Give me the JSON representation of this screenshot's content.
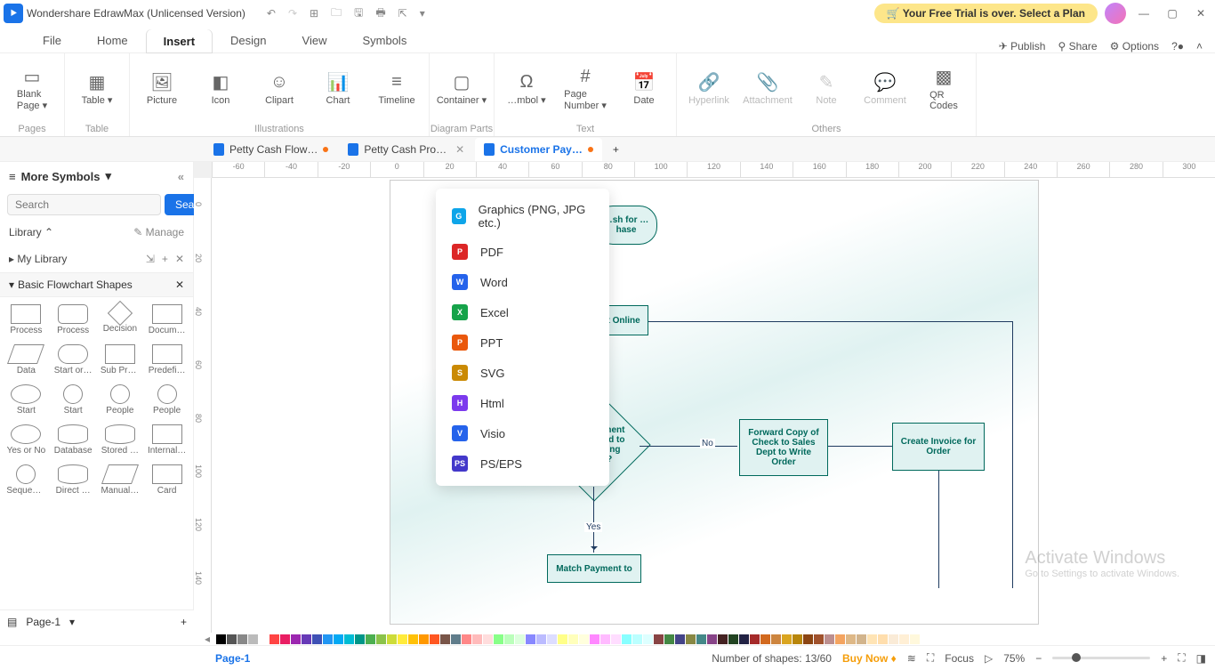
{
  "app": {
    "title": "Wondershare EdrawMax (Unlicensed Version)",
    "trial_banner": "Your Free Trial is over. Select a Plan"
  },
  "menu": {
    "tabs": [
      "File",
      "Home",
      "Insert",
      "Design",
      "View",
      "Symbols"
    ],
    "active": "Insert",
    "right": {
      "publish": "Publish",
      "share": "Share",
      "options": "Options"
    }
  },
  "ribbon": {
    "groups": [
      {
        "label": "Pages",
        "items": [
          {
            "name": "blank-page",
            "label": "Blank\nPage ▾",
            "icon": "▭"
          }
        ]
      },
      {
        "label": "Table",
        "items": [
          {
            "name": "table",
            "label": "Table ▾",
            "icon": "▦"
          }
        ]
      },
      {
        "label": "Illustrations",
        "items": [
          {
            "name": "picture",
            "label": "Picture",
            "icon": "🖼"
          },
          {
            "name": "icon",
            "label": "Icon",
            "icon": "◧"
          },
          {
            "name": "clipart",
            "label": "Clipart",
            "icon": "☺"
          },
          {
            "name": "chart",
            "label": "Chart",
            "icon": "📊"
          },
          {
            "name": "timeline",
            "label": "Timeline",
            "icon": "≡"
          }
        ]
      },
      {
        "label": "Diagram Parts",
        "items": [
          {
            "name": "container",
            "label": "Container ▾",
            "icon": "▢"
          }
        ]
      },
      {
        "label": "Text",
        "items": [
          {
            "name": "symbol",
            "label": "…mbol ▾",
            "icon": "Ω"
          },
          {
            "name": "page-number",
            "label": "Page\nNumber ▾",
            "icon": "#"
          },
          {
            "name": "date",
            "label": "Date",
            "icon": "📅"
          }
        ]
      },
      {
        "label": "Others",
        "items": [
          {
            "name": "hyperlink",
            "label": "Hyperlink",
            "icon": "🔗",
            "disabled": true
          },
          {
            "name": "attachment",
            "label": "Attachment",
            "icon": "📎",
            "disabled": true
          },
          {
            "name": "note",
            "label": "Note",
            "icon": "✎",
            "disabled": true
          },
          {
            "name": "comment",
            "label": "Comment",
            "icon": "💬",
            "disabled": true
          },
          {
            "name": "qr",
            "label": "QR\nCodes",
            "icon": "▩"
          }
        ]
      }
    ]
  },
  "dropdown": {
    "items": [
      {
        "label": "Graphics (PNG, JPG etc.)",
        "color": "#0ea5e9",
        "tag": "G"
      },
      {
        "label": "PDF",
        "color": "#dc2626",
        "tag": "P"
      },
      {
        "label": "Word",
        "color": "#2563eb",
        "tag": "W"
      },
      {
        "label": "Excel",
        "color": "#16a34a",
        "tag": "X"
      },
      {
        "label": "PPT",
        "color": "#ea580c",
        "tag": "P"
      },
      {
        "label": "SVG",
        "color": "#ca8a04",
        "tag": "S"
      },
      {
        "label": "Html",
        "color": "#7c3aed",
        "tag": "H"
      },
      {
        "label": "Visio",
        "color": "#2563eb",
        "tag": "V"
      },
      {
        "label": "PS/EPS",
        "color": "#4338ca",
        "tag": "PS"
      }
    ]
  },
  "doctabs": [
    {
      "label": "Petty Cash Flow…",
      "active": false,
      "modified": true
    },
    {
      "label": "Petty Cash Pro…",
      "active": false,
      "modified": false,
      "close": true
    },
    {
      "label": "Customer Pay…",
      "active": true,
      "modified": true
    }
  ],
  "sidebar": {
    "title": "More Symbols",
    "search_placeholder": "Search",
    "search_btn": "Search",
    "library": "Library",
    "manage": "Manage",
    "mylib": "My Library",
    "section": "Basic Flowchart Shapes",
    "shapes": [
      {
        "label": "Process",
        "cls": "rect"
      },
      {
        "label": "Process",
        "cls": "rrect"
      },
      {
        "label": "Decision",
        "cls": "diamond"
      },
      {
        "label": "Docum…",
        "cls": "rect"
      },
      {
        "label": "Data",
        "cls": "para"
      },
      {
        "label": "Start or…",
        "cls": "pill"
      },
      {
        "label": "Sub Pro…",
        "cls": "rect"
      },
      {
        "label": "Predefi…",
        "cls": "rect"
      },
      {
        "label": "Start",
        "cls": "ellipse"
      },
      {
        "label": "Start",
        "cls": "circ"
      },
      {
        "label": "People",
        "cls": "circ"
      },
      {
        "label": "People",
        "cls": "circ"
      },
      {
        "label": "Yes or No",
        "cls": "ellipse"
      },
      {
        "label": "Database",
        "cls": "cyl"
      },
      {
        "label": "Stored …",
        "cls": "cyl"
      },
      {
        "label": "Internal…",
        "cls": "rect"
      },
      {
        "label": "Sequen…",
        "cls": "circ"
      },
      {
        "label": "Direct …",
        "cls": "cyl"
      },
      {
        "label": "Manual…",
        "cls": "para"
      },
      {
        "label": "Card",
        "cls": "rect"
      }
    ]
  },
  "flowchart": {
    "n1": "…sh for\n…hase",
    "n2": "Make Payment Online",
    "n3": "Does Payment Correspond to Outstanding Invoice?",
    "n4": "Forward Copy of Check to Sales Dept to Write Order",
    "n5": "Create Invoice for Order",
    "n6": "Match Payment to",
    "no": "No",
    "yes": "Yes"
  },
  "ruler_h": [
    "-60",
    "-40",
    "-20",
    "0",
    "20",
    "40",
    "60",
    "80",
    "100",
    "120",
    "140",
    "160",
    "180",
    "200",
    "220",
    "240",
    "260",
    "280",
    "300"
  ],
  "ruler_v": [
    "0",
    "20",
    "40",
    "60",
    "80",
    "100",
    "120",
    "140"
  ],
  "colors": [
    "#000",
    "#555",
    "#888",
    "#bbb",
    "#fff",
    "#f44",
    "#e91e63",
    "#9c27b0",
    "#673ab7",
    "#3f51b5",
    "#2196f3",
    "#03a9f4",
    "#00bcd4",
    "#009688",
    "#4caf50",
    "#8bc34a",
    "#cddc39",
    "#ffeb3b",
    "#ffc107",
    "#ff9800",
    "#ff5722",
    "#795548",
    "#607d8b",
    "#f88",
    "#fbb",
    "#fdd",
    "#8f8",
    "#bfb",
    "#dfd",
    "#88f",
    "#bbf",
    "#ddf",
    "#ff8",
    "#ffb",
    "#ffd",
    "#f8f",
    "#fbf",
    "#fdf",
    "#8ff",
    "#bff",
    "#dff",
    "#844",
    "#484",
    "#448",
    "#884",
    "#488",
    "#848",
    "#422",
    "#242",
    "#224",
    "#a52a2a",
    "#d2691e",
    "#cd853f",
    "#daa520",
    "#b8860b",
    "#8b4513",
    "#a0522d",
    "#bc8f8f",
    "#f4a460",
    "#deb887",
    "#d2b48c",
    "#ffe4b5",
    "#ffdead",
    "#faebd7",
    "#ffefd5",
    "#fff8dc"
  ],
  "status": {
    "page": "Page-1",
    "shapes": "Number of shapes: 13/60",
    "buy": "Buy Now",
    "focus": "Focus",
    "zoom": "75%"
  },
  "watermark": {
    "line1": "Activate Windows",
    "line2": "Go to Settings to activate Windows."
  }
}
